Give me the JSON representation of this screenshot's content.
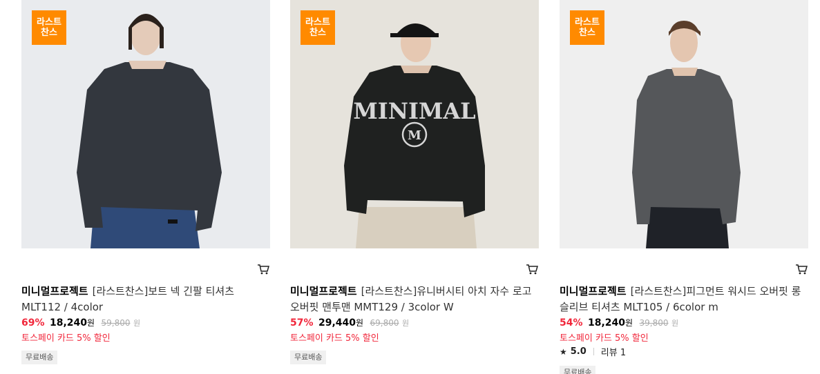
{
  "products": [
    {
      "badge_line1": "라스트",
      "badge_line2": "찬스",
      "brand": "미니멀프로젝트",
      "name": "[라스트찬스]보트 넥 긴팔 티셔츠 MLT112 / 4color",
      "discount": "69%",
      "price": "18,240",
      "price_unit": "원",
      "original_price": "59,800",
      "original_unit": "원",
      "promo": "토스페이 카드 5% 할인",
      "shipping": "무료배송",
      "image_label": "dark navy boat-neck long sleeve tee model"
    },
    {
      "badge_line1": "라스트",
      "badge_line2": "찬스",
      "brand": "미니멀프로젝트",
      "name": "[라스트찬스]유니버시티 아치 자수 로고 오버핏 맨투맨 MMT129 / 3color W",
      "discount": "57%",
      "price": "29,440",
      "price_unit": "원",
      "original_price": "69,800",
      "original_unit": "원",
      "promo": "토스페이 카드 5% 할인",
      "shipping": "무료배송",
      "image_label": "black MINIMAL sweatshirt model with cap"
    },
    {
      "badge_line1": "라스트",
      "badge_line2": "찬스",
      "brand": "미니멀프로젝트",
      "name": "[라스트찬스]피그먼트 워시드 오버핏 롱슬리브 티셔츠 MLT105 / 6color m",
      "discount": "54%",
      "price": "18,240",
      "price_unit": "원",
      "original_price": "39,800",
      "original_unit": "원",
      "promo": "토스페이 카드 5% 할인",
      "rating_score": "5.0",
      "review_label": "리뷰 1",
      "shipping": "무료배송",
      "image_label": "charcoal pigment washed long sleeve tee model"
    }
  ],
  "graphics": {
    "sweatshirt_text": "MINIMAL"
  },
  "colors": {
    "badge": "#ff8a00",
    "discount": "#f1273b"
  }
}
